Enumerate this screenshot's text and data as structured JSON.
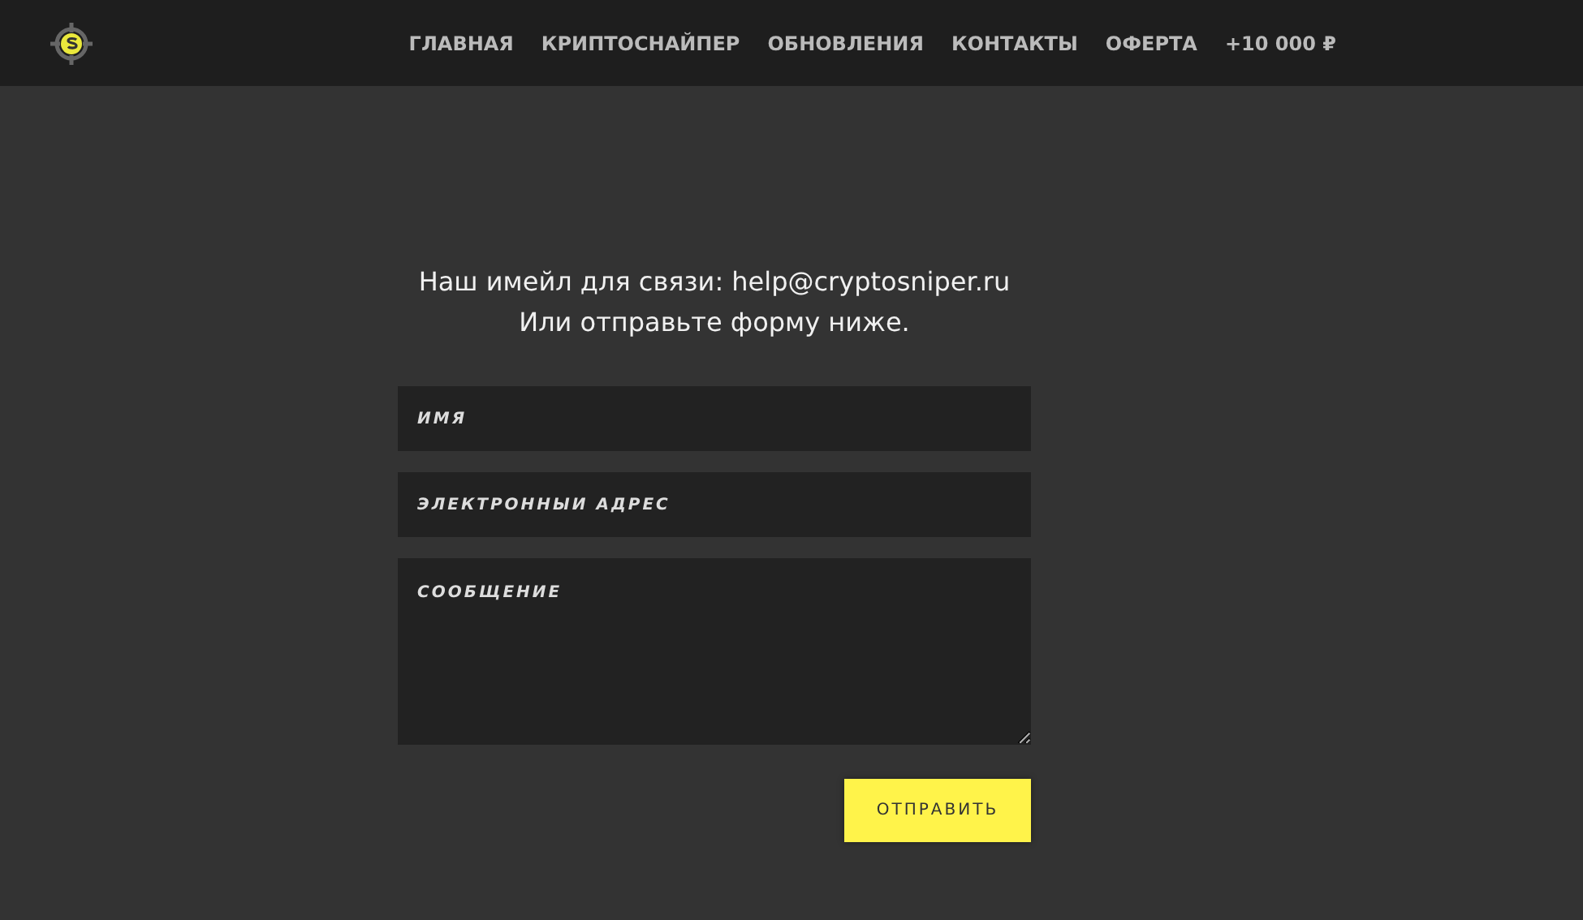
{
  "nav": {
    "items": [
      {
        "label": "ГЛАВНАЯ"
      },
      {
        "label": "КРИПТОСНАЙПЕР"
      },
      {
        "label": "ОБНОВЛЕНИЯ"
      },
      {
        "label": "КОНТАКТЫ"
      },
      {
        "label": "ОФЕРТА"
      },
      {
        "label": "+10 000 ₽"
      }
    ]
  },
  "intro": {
    "line_1": "Наш имейл для связи: help@cryptosniper.ru",
    "line_2": "Или отправьте форму ниже."
  },
  "form": {
    "fields": [
      {
        "kind": "input",
        "placeholder": "ИМЯ"
      },
      {
        "kind": "input",
        "placeholder": "ЭЛЕКТРОННЫЙ АДРЕС"
      },
      {
        "kind": "textarea",
        "placeholder": "СООБЩЕНИЕ"
      }
    ],
    "submit": "ОТПРАВИТЬ"
  }
}
